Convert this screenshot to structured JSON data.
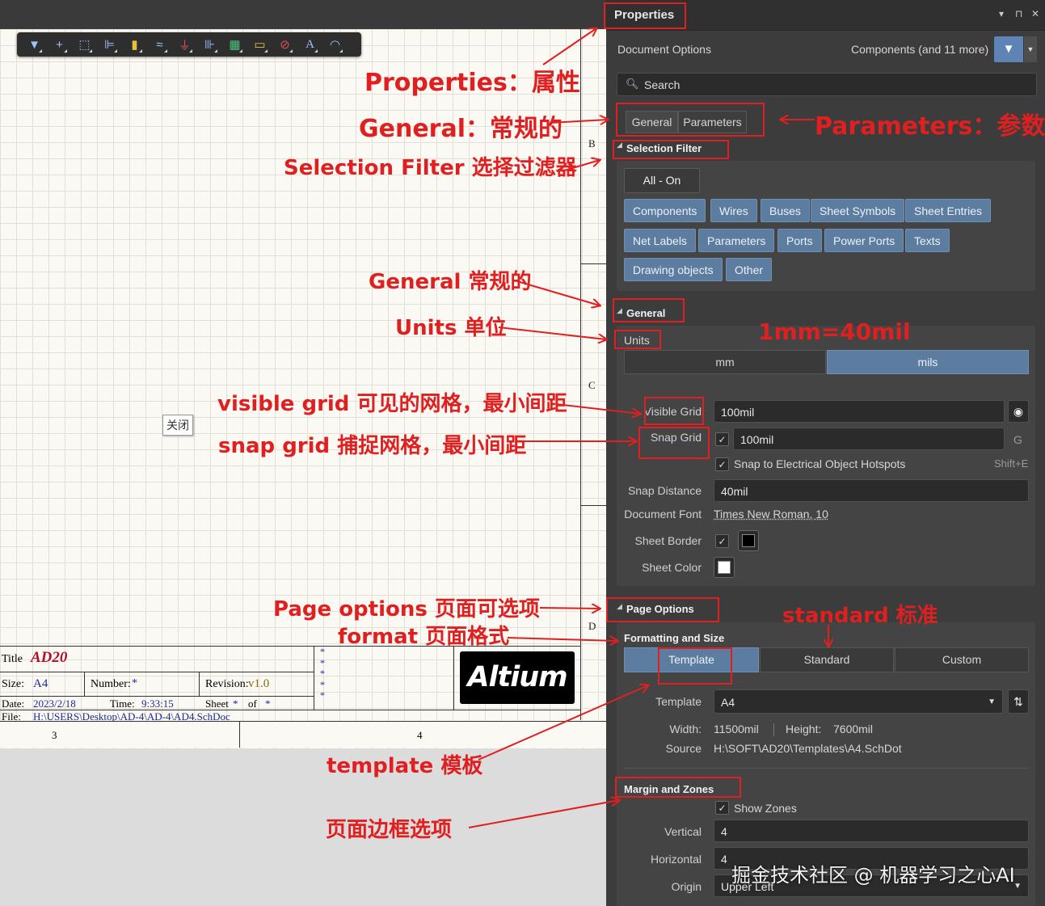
{
  "panel": {
    "title": "Properties",
    "header_icons": [
      "▾",
      "⊓",
      "✕"
    ],
    "document_options": "Document Options",
    "components_label": "Components (and 11 more)",
    "search_placeholder": "Search",
    "tabs": [
      "General",
      "Parameters"
    ],
    "selection_filter": {
      "title": "Selection Filter",
      "all_on": "All - On",
      "buttons": [
        "Components",
        "Wires",
        "Buses",
        "Sheet Symbols",
        "Sheet Entries",
        "Net Labels",
        "Parameters",
        "Ports",
        "Power Ports",
        "Texts",
        "Drawing objects",
        "Other"
      ]
    },
    "general": {
      "title": "General",
      "units_label": "Units",
      "units_options": [
        "mm",
        "mils"
      ],
      "units_selected": "mils",
      "visible_grid_label": "Visible Grid",
      "visible_grid_value": "100mil",
      "snap_grid_label": "Snap Grid",
      "snap_grid_value": "100mil",
      "snap_grid_shortcut": "G",
      "snap_hotspots_label": "Snap to Electrical Object Hotspots",
      "snap_hotspots_shortcut": "Shift+E",
      "snap_distance_label": "Snap Distance",
      "snap_distance_value": "40mil",
      "document_font_label": "Document Font",
      "document_font_value": "Times New Roman, 10",
      "sheet_border_label": "Sheet Border",
      "sheet_color_label": "Sheet Color"
    },
    "page_options": {
      "title": "Page Options",
      "formatting_title": "Formatting and Size",
      "format_tabs": [
        "Template",
        "Standard",
        "Custom"
      ],
      "format_selected": "Template",
      "template_label": "Template",
      "template_value": "A4",
      "width_label": "Width:",
      "width_value": "11500mil",
      "height_label": "Height:",
      "height_value": "7600mil",
      "source_label": "Source",
      "source_value": "H:\\SOFT\\AD20\\Templates\\A4.SchDot",
      "margin_title": "Margin and Zones",
      "show_zones_label": "Show Zones",
      "vertical_label": "Vertical",
      "vertical_value": "4",
      "horizontal_label": "Horizontal",
      "horizontal_value": "4",
      "origin_label": "Origin",
      "origin_value": "Upper Left"
    }
  },
  "canvas": {
    "zone_letters": [
      "B",
      "C",
      "D"
    ],
    "close_tooltip": "关闭",
    "title_block": {
      "title_label": "Title",
      "title_value": "AD20",
      "size_label": "Size:",
      "size_value": "A4",
      "number_label": "Number:",
      "number_value": "*",
      "revision_label": "Revision:",
      "revision_value": "v1.0",
      "date_label": "Date:",
      "date_value": "2023/2/18",
      "time_label": "Time:",
      "time_value": "9:33:15",
      "sheet_label": "Sheet",
      "sheet_value": "*",
      "of_label": "of",
      "of_value": "*",
      "file_label": "File:",
      "file_value": "H:\\USERS\\Desktop\\AD-4\\AD-4\\AD4.SchDoc",
      "stars": [
        "*",
        "*",
        "*",
        "*",
        "*"
      ],
      "logo_text": "Altium"
    },
    "ruler_numbers": [
      "3",
      "4"
    ]
  },
  "annotations": {
    "properties": "Properties：属性",
    "general_top": "General：常规的",
    "parameters": "Parameters：参数",
    "selection_filter": "Selection Filter 选择过滤器",
    "general_mid": "General 常规的",
    "units": "Units 单位",
    "mm_mil": "1mm=40mil",
    "visible_grid": "visible grid 可见的网格，最小间距",
    "snap_grid": "snap grid 捕捉网格，最小间距",
    "page_options": "Page options 页面可选项",
    "format": "format 页面格式",
    "standard": "standard 标准",
    "template": "template 模板",
    "margin": "页面边框选项"
  },
  "watermark": "掘金技术社区 @ 机器学习之心AI",
  "colors": {
    "accent_blue": "#5d7da0",
    "annotation_red": "#e02020",
    "panel_bg": "#3c3c3c"
  }
}
